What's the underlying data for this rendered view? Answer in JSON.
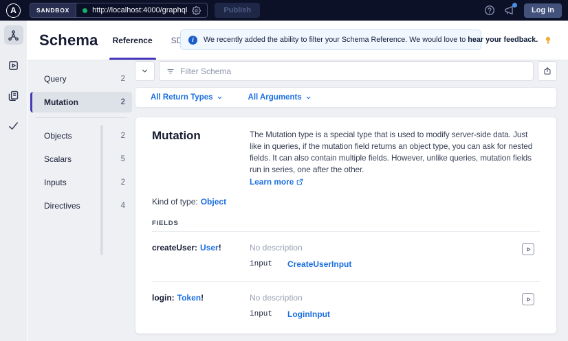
{
  "colors": {
    "topbar_bg": "#0c1127",
    "accent_indigo": "#4437b8",
    "link_blue": "#1b6fe0",
    "status_green": "#17b169",
    "banner_bg": "#f1f7fe"
  },
  "topbar": {
    "logo_letter": "A",
    "sandbox_label": "SANDBOX",
    "endpoint_url": "http://localhost:4000/graphql",
    "publish_label": "Publish",
    "login_label": "Log in",
    "icons": [
      "gear-icon",
      "help-icon",
      "megaphone-icon"
    ]
  },
  "rail": {
    "items": [
      {
        "icon": "schema-graph-icon",
        "active": true
      },
      {
        "icon": "explorer-play-icon",
        "active": false
      },
      {
        "icon": "collections-icon",
        "active": false
      },
      {
        "icon": "checks-icon",
        "active": false
      }
    ]
  },
  "header": {
    "title": "Schema",
    "tabs": [
      {
        "label": "Reference",
        "active": true
      },
      {
        "label": "SDL",
        "active": false
      }
    ],
    "banner": {
      "prefix": "We recently added the ability to filter your Schema Reference. We would love to ",
      "link": "hear your feedback.",
      "icons": [
        "info-icon",
        "lightbulb-icon"
      ]
    }
  },
  "sidebar": {
    "items": [
      {
        "label": "Query",
        "count": 2,
        "active": false
      },
      {
        "label": "Mutation",
        "count": 2,
        "active": true
      },
      {
        "label": "Objects",
        "count": 2,
        "active": false
      },
      {
        "label": "Scalars",
        "count": 5,
        "active": false
      },
      {
        "label": "Inputs",
        "count": 2,
        "active": false
      },
      {
        "label": "Directives",
        "count": 4,
        "active": false
      }
    ]
  },
  "filter": {
    "placeholder": "Filter Schema",
    "icons": [
      "chevron-down-icon",
      "filter-lines-icon",
      "share-icon"
    ]
  },
  "chips": [
    {
      "label": "All Return Types"
    },
    {
      "label": "All Arguments"
    }
  ],
  "content": {
    "type_name": "Mutation",
    "description": "The Mutation type is a special type that is used to modify server-side data. Just like in queries, if the mutation field returns an object type, you can ask for nested fields. It can also contain multiple fields. However, unlike queries, mutation fields run in series, one after the other.",
    "learn_more_label": "Learn more",
    "kind_label": "Kind of type:",
    "kind_value": "Object",
    "fields_label": "FIELDS",
    "fields": [
      {
        "name": "createUser:",
        "type": "User",
        "bang": "!",
        "description": "No description",
        "arg_kind": "input",
        "arg_type": "CreateUserInput"
      },
      {
        "name": "login:",
        "type": "Token",
        "bang": "!",
        "description": "No description",
        "arg_kind": "input",
        "arg_type": "LoginInput"
      }
    ]
  }
}
